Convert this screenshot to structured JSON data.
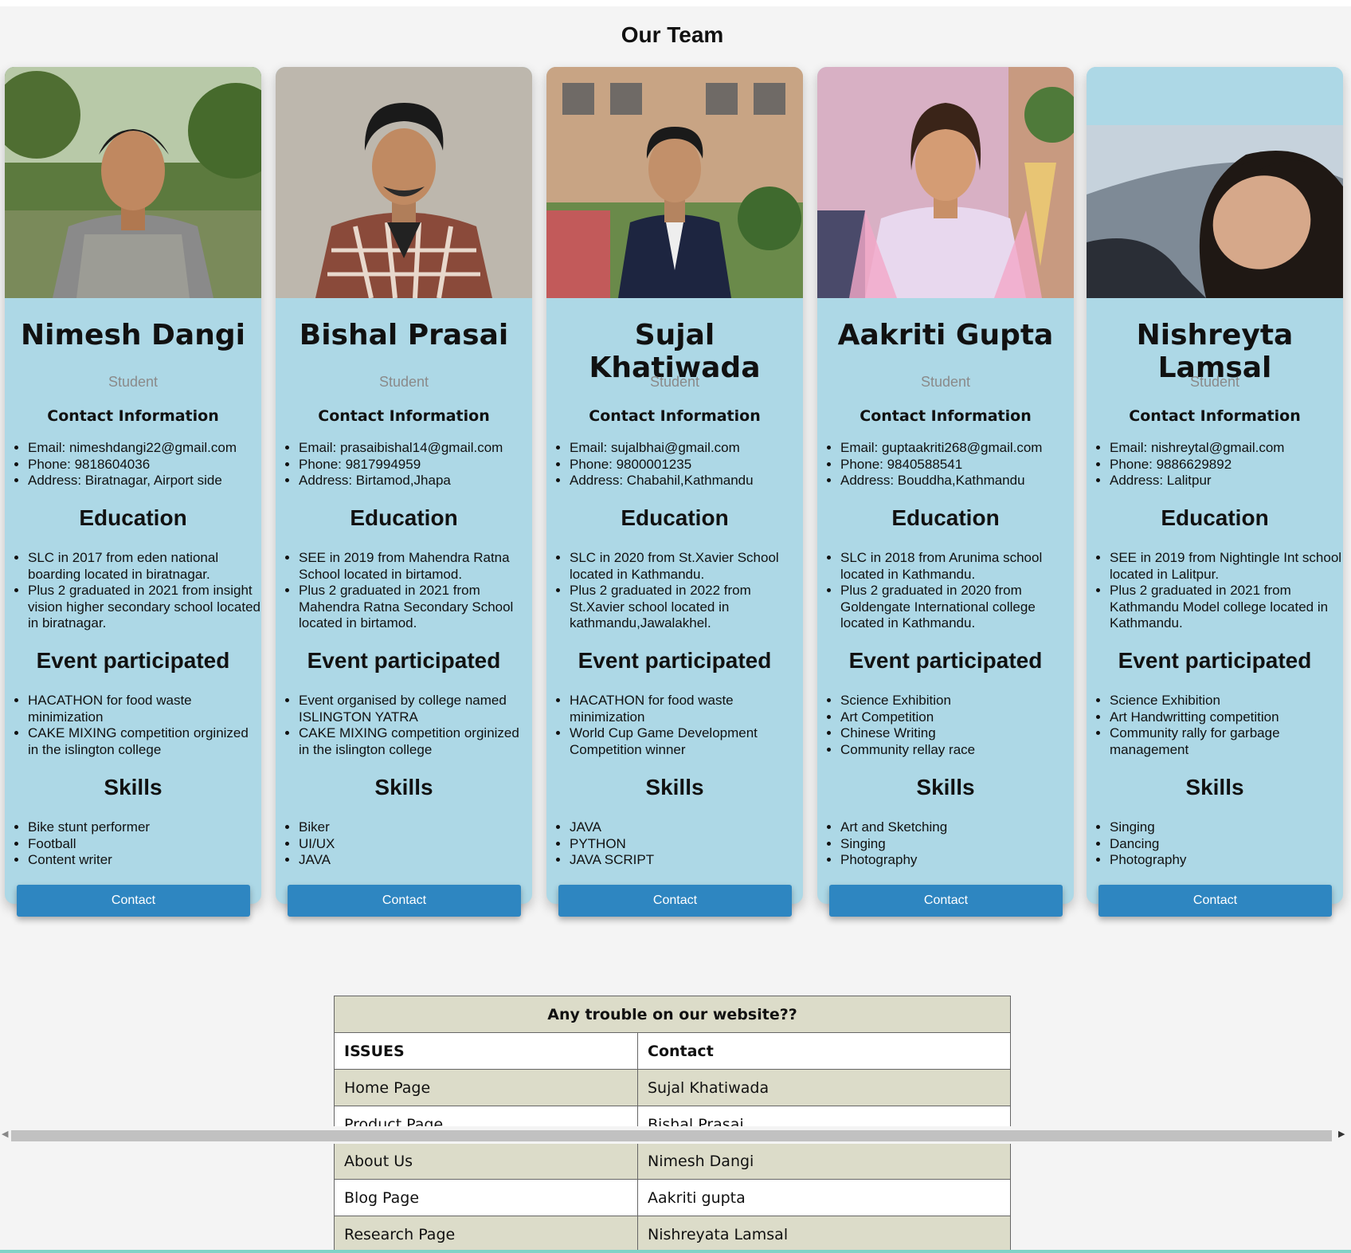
{
  "page": {
    "title": "Our Team"
  },
  "members": [
    {
      "name": "Nimesh Dangi",
      "role": "Student",
      "contact_heading": "Contact Information",
      "contact": [
        "Email: nimeshdangi22@gmail.com",
        "Phone: 9818604036",
        "Address: Biratnagar, Airport side"
      ],
      "education_heading": "Education",
      "education": [
        "SLC in 2017 from eden national boarding located in biratnagar.",
        "Plus 2 graduated in 2021 from insight vision higher secondary school located in biratnagar."
      ],
      "events_heading": "Event participated",
      "events": [
        "HACATHON for food waste minimization",
        "CAKE MIXING competition orginized in the islington college"
      ],
      "skills_heading": "Skills",
      "skills": [
        "Bike stunt performer",
        "Football",
        "Content writer"
      ],
      "button": "Contact"
    },
    {
      "name": "Bishal Prasai",
      "role": "Student",
      "contact_heading": "Contact Information",
      "contact": [
        "Email: prasaibishal14@gmail.com",
        "Phone: 9817994959",
        "Address: Birtamod,Jhapa"
      ],
      "education_heading": "Education",
      "education": [
        "SEE in 2019 from Mahendra Ratna School located in birtamod.",
        "Plus 2 graduated in 2021 from Mahendra Ratna Secondary School located in birtamod."
      ],
      "events_heading": "Event participated",
      "events": [
        "Event organised by college named ISLINGTON YATRA",
        "CAKE MIXING competition orginized in the islington college"
      ],
      "skills_heading": "Skills",
      "skills": [
        "Biker",
        "UI/UX",
        "JAVA"
      ],
      "button": "Contact"
    },
    {
      "name": "Sujal Khatiwada",
      "role": "Student",
      "contact_heading": "Contact Information",
      "contact": [
        "Email: sujalbhai@gmail.com",
        "Phone: 9800001235",
        "Address: Chabahil,Kathmandu"
      ],
      "education_heading": "Education",
      "education": [
        "SLC in 2020 from St.Xavier School located in Kathmandu.",
        "Plus 2 graduated in 2022 from St.Xavier school located in kathmandu,Jawalakhel."
      ],
      "events_heading": "Event participated",
      "events": [
        "HACATHON for food waste minimization",
        "World Cup Game Development Competition winner"
      ],
      "skills_heading": "Skills",
      "skills": [
        "JAVA",
        "PYTHON",
        "JAVA SCRIPT"
      ],
      "button": "Contact"
    },
    {
      "name": "Aakriti Gupta",
      "role": "Student",
      "contact_heading": "Contact Information",
      "contact": [
        "Email: guptaakriti268@gmail.com",
        "Phone: 9840588541",
        "Address: Bouddha,Kathmandu"
      ],
      "education_heading": "Education",
      "education": [
        "SLC in 2018 from Arunima school located in Kathmandu.",
        "Plus 2 graduated in 2020 from Goldengate International college located in Kathmandu."
      ],
      "events_heading": "Event participated",
      "events": [
        "Science Exhibition",
        "Art Competition",
        "Chinese Writing",
        "Community rellay race"
      ],
      "skills_heading": "Skills",
      "skills": [
        "Art and Sketching",
        "Singing",
        "Photography"
      ],
      "button": "Contact"
    },
    {
      "name": "Nishreyta Lamsal",
      "role": "Student",
      "contact_heading": "Contact Information",
      "contact": [
        "Email: nishreytal@gmail.com",
        "Phone: 9886629892",
        "Address: Lalitpur"
      ],
      "education_heading": "Education",
      "education": [
        "SEE in 2019 from Nightingle Int school located in Lalitpur.",
        "Plus 2 graduated in 2021 from Kathmandu Model college located in Kathmandu."
      ],
      "events_heading": "Event participated",
      "events": [
        "Science Exhibition",
        "Art Handwritting competition",
        "Community rally for garbage management"
      ],
      "skills_heading": "Skills",
      "skills": [
        "Singing",
        "Dancing",
        "Photography"
      ],
      "button": "Contact"
    }
  ],
  "issues_table": {
    "caption": "Any trouble on our website??",
    "headers": [
      "ISSUES",
      "Contact"
    ],
    "rows": [
      [
        "Home Page",
        "Sujal Khatiwada"
      ],
      [
        "Product Page",
        "Bishal Prasai"
      ],
      [
        "About Us",
        "Nimesh Dangi"
      ],
      [
        "Blog Page",
        "Aakriti gupta"
      ],
      [
        "Research Page",
        "Nishreyata Lamsal"
      ]
    ]
  },
  "colors": {
    "card_bg": "#add8e6",
    "button_bg": "#2e86c1",
    "table_alt": "#dcdcc9",
    "page_bg": "#f4f4f4"
  },
  "icons": {
    "scroll_left": "triangle-left-icon",
    "scroll_right": "triangle-right-icon"
  }
}
